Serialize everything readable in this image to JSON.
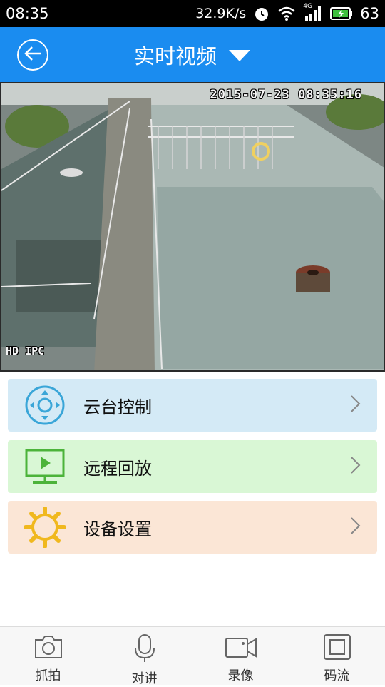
{
  "status_bar": {
    "time": "08:35",
    "net_speed": "32.9K/s",
    "network": "4G",
    "battery": "63"
  },
  "app_bar": {
    "title": "实时视频",
    "back_icon": "back-arrow-icon",
    "dropdown_icon": "triangle-down-icon"
  },
  "video": {
    "timestamp": "2015-07-23 08:35:16",
    "label": "HD IPC"
  },
  "menu": {
    "items": [
      {
        "label": "云台控制",
        "icon": "ptz-control-icon",
        "bg": "#d4eaf6",
        "icon_color": "#3aa6d8"
      },
      {
        "label": "远程回放",
        "icon": "playback-monitor-icon",
        "bg": "#d9f7d5",
        "icon_color": "#4cb33a"
      },
      {
        "label": "设备设置",
        "icon": "gear-icon",
        "bg": "#fbe6d6",
        "icon_color": "#f0b81e"
      }
    ]
  },
  "bottom_tabs": [
    {
      "label": "抓拍",
      "icon": "camera-icon"
    },
    {
      "label": "对讲",
      "icon": "microphone-icon"
    },
    {
      "label": "录像",
      "icon": "video-camera-icon"
    },
    {
      "label": "码流",
      "icon": "stream-square-icon"
    }
  ],
  "colors": {
    "accent": "#1a8cf0"
  }
}
